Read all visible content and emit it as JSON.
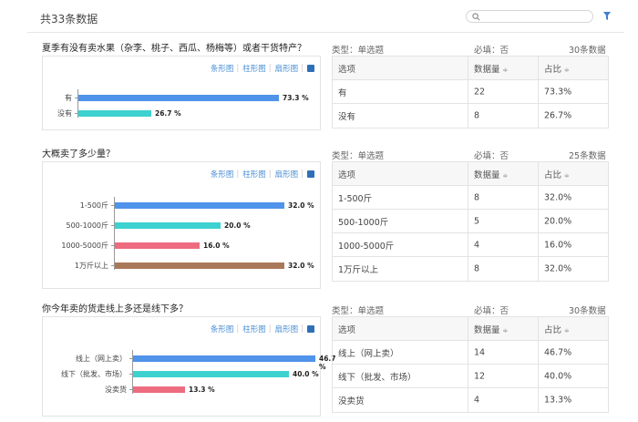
{
  "page": {
    "title": "共33条数据",
    "search_placeholder": ""
  },
  "tools": {
    "bar": "条形图",
    "column": "柱形图",
    "pie": "扇形图"
  },
  "table_headers": {
    "option": "选项",
    "count": "数据量",
    "ratio": "占比",
    "sort_mark": "≑"
  },
  "colors": {
    "blue": "#4f93ea",
    "teal": "#3dd1d0",
    "pink": "#ee6c7f",
    "brown": "#a9785a",
    "link": "#4a8fd6"
  },
  "questions": [
    {
      "title": "夏季有没有卖水果（杂李、桃子、西瓜、杨梅等）或者干货特产？",
      "type": "类型：单选题",
      "required": "必填：否",
      "total": "30条数据",
      "options": [
        {
          "label": "有",
          "count": "22",
          "ratio": "73.3%",
          "bar_label": "73.3 %",
          "value": 73.3,
          "color": "blue"
        },
        {
          "label": "没有",
          "count": "8",
          "ratio": "26.7%",
          "bar_label": "26.7 %",
          "value": 26.7,
          "color": "teal"
        }
      ]
    },
    {
      "title": "大概卖了多少量？",
      "type": "类型：单选题",
      "required": "必填：否",
      "total": "25条数据",
      "options": [
        {
          "label": "1-500斤",
          "count": "8",
          "ratio": "32.0%",
          "bar_label": "32.0 %",
          "value": 32.0,
          "color": "blue"
        },
        {
          "label": "500-1000斤",
          "count": "5",
          "ratio": "20.0%",
          "bar_label": "20.0 %",
          "value": 20.0,
          "color": "teal"
        },
        {
          "label": "1000-5000斤",
          "count": "4",
          "ratio": "16.0%",
          "bar_label": "16.0 %",
          "value": 16.0,
          "color": "pink"
        },
        {
          "label": "1万斤以上",
          "count": "8",
          "ratio": "32.0%",
          "bar_label": "32.0 %",
          "value": 32.0,
          "color": "brown"
        }
      ]
    },
    {
      "title": "你今年卖的货走线上多还是线下多？",
      "type": "类型：单选题",
      "required": "必填：否",
      "total": "30条数据",
      "options": [
        {
          "label": "线上（网上卖）",
          "count": "14",
          "ratio": "46.7%",
          "bar_label": "46.7 %",
          "value": 46.7,
          "color": "blue"
        },
        {
          "label": "线下（批发、市场）",
          "count": "12",
          "ratio": "40.0%",
          "bar_label": "40.0 %",
          "value": 40.0,
          "color": "teal"
        },
        {
          "label": "没卖货",
          "count": "4",
          "ratio": "13.3%",
          "bar_label": "13.3 %",
          "value": 13.3,
          "color": "pink"
        }
      ]
    }
  ]
}
